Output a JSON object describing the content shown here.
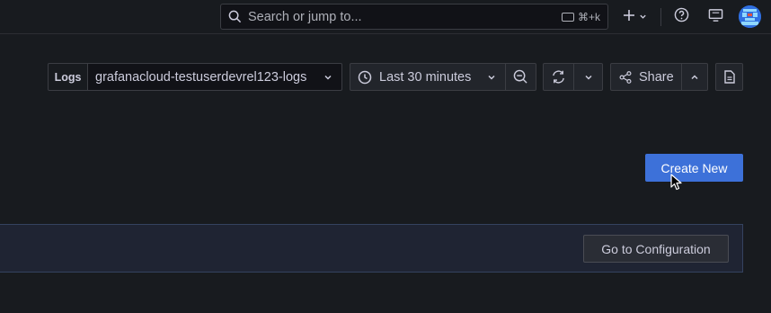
{
  "topbar": {
    "search_placeholder": "Search or jump to...",
    "search_shortcut": "⌘+k"
  },
  "toolbar": {
    "datasource_label": "Logs",
    "datasource_value": "grafanacloud-testuserdevrel123-logs",
    "time_range": "Last 30 minutes",
    "share_label": "Share"
  },
  "main": {
    "create_new_label": "Create New",
    "go_to_config_label": "Go to Configuration"
  },
  "colors": {
    "background": "#181b1f",
    "primary": "#3d71d9",
    "banner": "#1f2433"
  }
}
